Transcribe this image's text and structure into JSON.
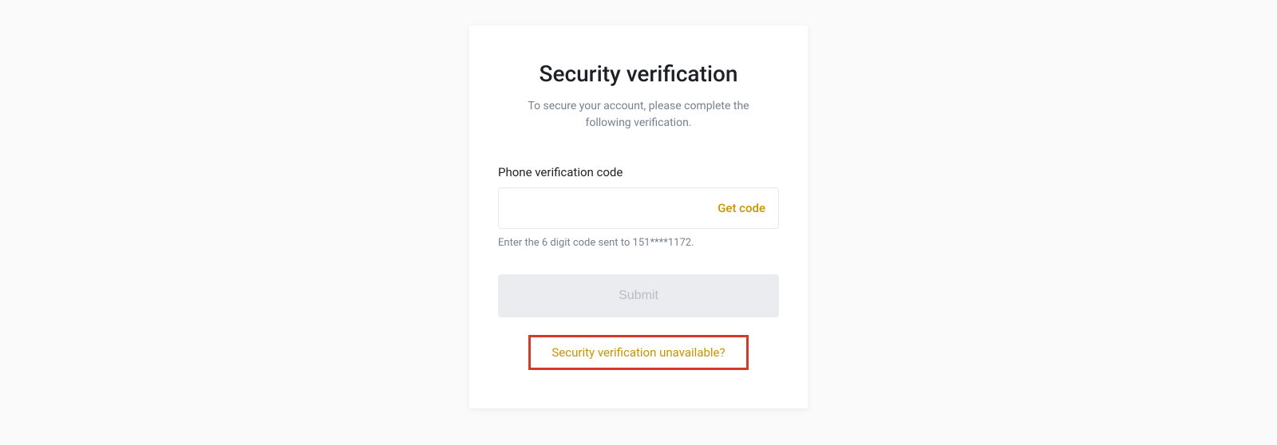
{
  "card": {
    "title": "Security verification",
    "subtitle": "To secure your account, please complete the following verification.",
    "field_label": "Phone verification code",
    "get_code_label": "Get code",
    "hint": "Enter the 6 digit code sent to 151****1172.",
    "submit_label": "Submit",
    "unavailable_label": "Security verification unavailable?"
  }
}
